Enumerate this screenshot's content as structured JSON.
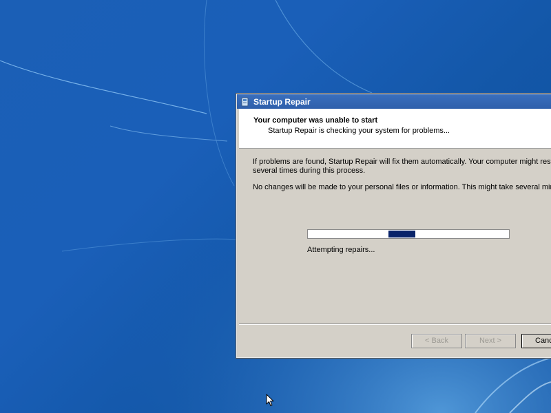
{
  "window": {
    "title": "Startup Repair",
    "header": {
      "title": "Your computer was unable to start",
      "subtitle": "Startup Repair is checking your system for problems..."
    },
    "body": {
      "paragraph1_line1": "If problems are found, Startup Repair will fix them automatically. Your computer might rest",
      "paragraph1_line2": "several times during this process.",
      "paragraph2": "No changes will be made to your personal files or information. This might take several minu"
    },
    "progress": {
      "status_text": "Attempting repairs...",
      "marquee_position": 0.4
    },
    "buttons": {
      "back_label": "< Back",
      "next_label": "Next >",
      "cancel_label": "Cancel"
    }
  },
  "icons": {
    "app_icon": "startup-repair-icon",
    "cursor": "mouse-pointer-icon"
  },
  "colors": {
    "desktop_blue": "#1a5fb8",
    "titlebar_blue": "#2e5fab",
    "dialog_gray": "#d4d0c8",
    "progress_chunk": "#0a246a"
  }
}
